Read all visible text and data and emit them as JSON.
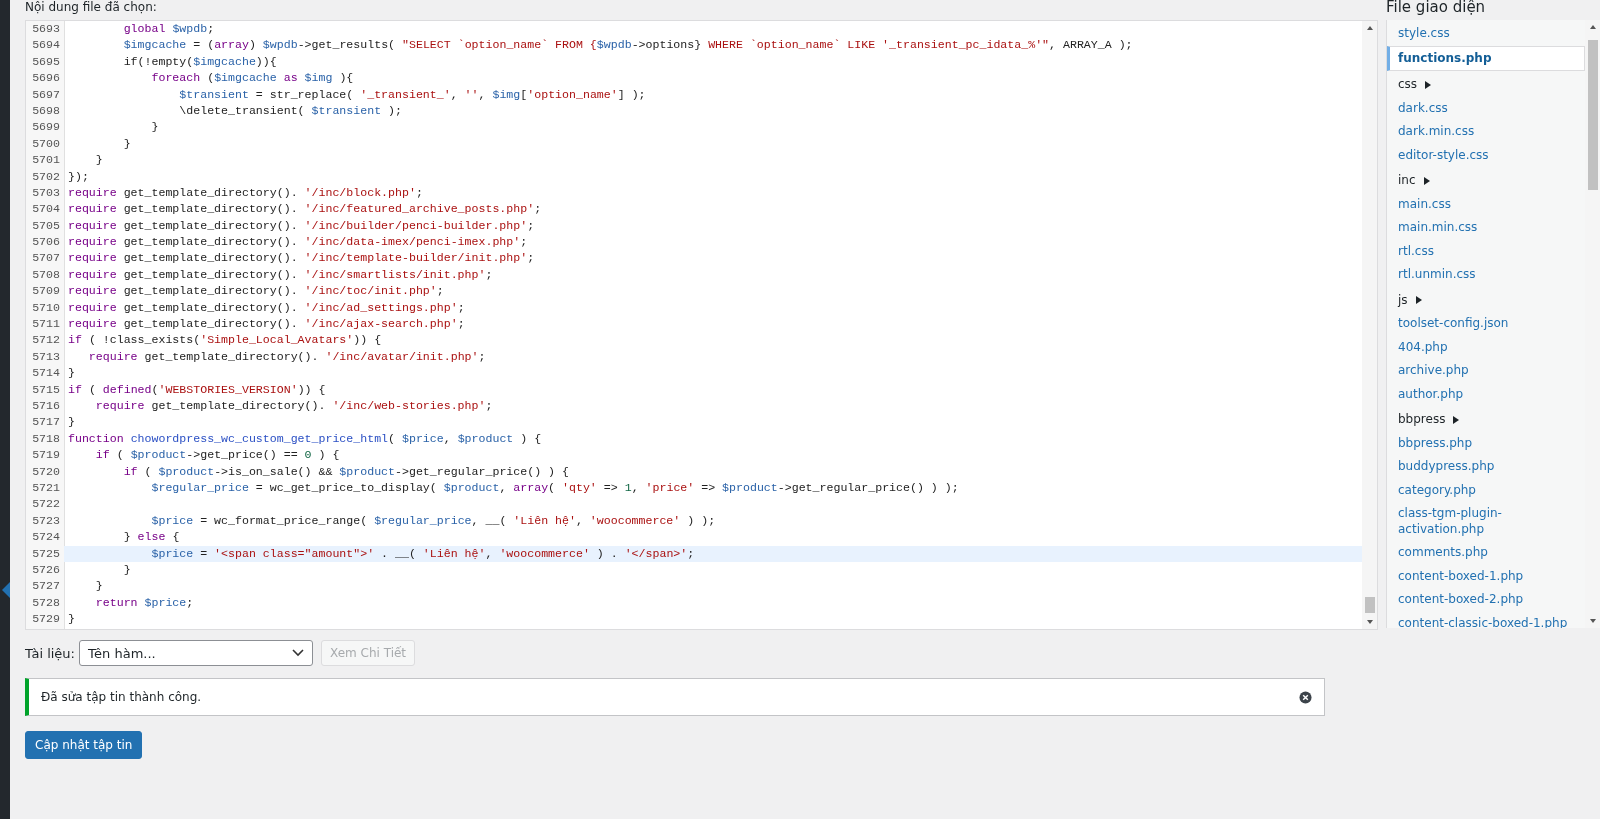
{
  "editor": {
    "heading": "Nội dung file đã chọn:",
    "lines": [
      {
        "number": "5693",
        "highlighted": false,
        "tokens": [
          {
            "kind": "keyword",
            "text": "        global "
          },
          {
            "kind": "variable",
            "text": "$wpdb"
          },
          {
            "kind": "plain",
            "text": ";"
          }
        ]
      },
      {
        "number": "5694",
        "highlighted": false,
        "tokens": [
          {
            "kind": "variable",
            "text": "        $imgcache"
          },
          {
            "kind": "plain",
            "text": " = ("
          },
          {
            "kind": "keyword",
            "text": "array"
          },
          {
            "kind": "plain",
            "text": ") "
          },
          {
            "kind": "variable",
            "text": "$wpdb"
          },
          {
            "kind": "plain",
            "text": "->get_results( "
          },
          {
            "kind": "string",
            "text": "\"SELECT `option_name` FROM {"
          },
          {
            "kind": "variable",
            "text": "$wpdb"
          },
          {
            "kind": "plain",
            "text": "->options}"
          },
          {
            "kind": "string",
            "text": " WHERE `option_name` LIKE '_transient_pc_idata_%'\""
          },
          {
            "kind": "plain",
            "text": ", ARRAY_A );"
          }
        ]
      },
      {
        "number": "5695",
        "highlighted": false,
        "tokens": [
          {
            "kind": "plain",
            "text": "        if(!empty("
          },
          {
            "kind": "variable",
            "text": "$imgcache"
          },
          {
            "kind": "plain",
            "text": ")){"
          }
        ]
      },
      {
        "number": "5696",
        "highlighted": false,
        "tokens": [
          {
            "kind": "keyword",
            "text": "            foreach"
          },
          {
            "kind": "plain",
            "text": " ("
          },
          {
            "kind": "variable",
            "text": "$imgcache "
          },
          {
            "kind": "keyword",
            "text": "as "
          },
          {
            "kind": "variable",
            "text": "$img"
          },
          {
            "kind": "plain",
            "text": " ){"
          }
        ]
      },
      {
        "number": "5697",
        "highlighted": false,
        "tokens": [
          {
            "kind": "variable",
            "text": "                $transient"
          },
          {
            "kind": "plain",
            "text": " = str_replace( "
          },
          {
            "kind": "string",
            "text": "'_transient_'"
          },
          {
            "kind": "plain",
            "text": ", "
          },
          {
            "kind": "string",
            "text": "''"
          },
          {
            "kind": "plain",
            "text": ", "
          },
          {
            "kind": "variable",
            "text": "$img"
          },
          {
            "kind": "plain",
            "text": "["
          },
          {
            "kind": "string",
            "text": "'option_name'"
          },
          {
            "kind": "plain",
            "text": "] );"
          }
        ]
      },
      {
        "number": "5698",
        "highlighted": false,
        "tokens": [
          {
            "kind": "plain",
            "text": "                \\delete_transient( "
          },
          {
            "kind": "variable",
            "text": "$transient"
          },
          {
            "kind": "plain",
            "text": " );"
          }
        ]
      },
      {
        "number": "5699",
        "highlighted": false,
        "tokens": [
          {
            "kind": "plain",
            "text": "            }"
          }
        ]
      },
      {
        "number": "5700",
        "highlighted": false,
        "tokens": [
          {
            "kind": "plain",
            "text": "        }"
          }
        ]
      },
      {
        "number": "5701",
        "highlighted": false,
        "tokens": [
          {
            "kind": "plain",
            "text": "    }"
          }
        ]
      },
      {
        "number": "5702",
        "highlighted": false,
        "tokens": [
          {
            "kind": "plain",
            "text": "});"
          }
        ]
      },
      {
        "number": "5703",
        "highlighted": false,
        "tokens": [
          {
            "kind": "keyword",
            "text": "require"
          },
          {
            "kind": "plain",
            "text": " get_template_directory(). "
          },
          {
            "kind": "string",
            "text": "'/inc/block.php'"
          },
          {
            "kind": "plain",
            "text": ";"
          }
        ]
      },
      {
        "number": "5704",
        "highlighted": false,
        "tokens": [
          {
            "kind": "keyword",
            "text": "require"
          },
          {
            "kind": "plain",
            "text": " get_template_directory(). "
          },
          {
            "kind": "string",
            "text": "'/inc/featured_archive_posts.php'"
          },
          {
            "kind": "plain",
            "text": ";"
          }
        ]
      },
      {
        "number": "5705",
        "highlighted": false,
        "tokens": [
          {
            "kind": "keyword",
            "text": "require"
          },
          {
            "kind": "plain",
            "text": " get_template_directory(). "
          },
          {
            "kind": "string",
            "text": "'/inc/builder/penci-builder.php'"
          },
          {
            "kind": "plain",
            "text": ";"
          }
        ]
      },
      {
        "number": "5706",
        "highlighted": false,
        "tokens": [
          {
            "kind": "keyword",
            "text": "require"
          },
          {
            "kind": "plain",
            "text": " get_template_directory(). "
          },
          {
            "kind": "string",
            "text": "'/inc/data-imex/penci-imex.php'"
          },
          {
            "kind": "plain",
            "text": ";"
          }
        ]
      },
      {
        "number": "5707",
        "highlighted": false,
        "tokens": [
          {
            "kind": "keyword",
            "text": "require"
          },
          {
            "kind": "plain",
            "text": " get_template_directory(). "
          },
          {
            "kind": "string",
            "text": "'/inc/template-builder/init.php'"
          },
          {
            "kind": "plain",
            "text": ";"
          }
        ]
      },
      {
        "number": "5708",
        "highlighted": false,
        "tokens": [
          {
            "kind": "keyword",
            "text": "require"
          },
          {
            "kind": "plain",
            "text": " get_template_directory(). "
          },
          {
            "kind": "string",
            "text": "'/inc/smartlists/init.php'"
          },
          {
            "kind": "plain",
            "text": ";"
          }
        ]
      },
      {
        "number": "5709",
        "highlighted": false,
        "tokens": [
          {
            "kind": "keyword",
            "text": "require"
          },
          {
            "kind": "plain",
            "text": " get_template_directory(). "
          },
          {
            "kind": "string",
            "text": "'/inc/toc/init.php'"
          },
          {
            "kind": "plain",
            "text": ";"
          }
        ]
      },
      {
        "number": "5710",
        "highlighted": false,
        "tokens": [
          {
            "kind": "keyword",
            "text": "require"
          },
          {
            "kind": "plain",
            "text": " get_template_directory(). "
          },
          {
            "kind": "string",
            "text": "'/inc/ad_settings.php'"
          },
          {
            "kind": "plain",
            "text": ";"
          }
        ]
      },
      {
        "number": "5711",
        "highlighted": false,
        "tokens": [
          {
            "kind": "keyword",
            "text": "require"
          },
          {
            "kind": "plain",
            "text": " get_template_directory(). "
          },
          {
            "kind": "string",
            "text": "'/inc/ajax-search.php'"
          },
          {
            "kind": "plain",
            "text": ";"
          }
        ]
      },
      {
        "number": "5712",
        "highlighted": false,
        "tokens": [
          {
            "kind": "keyword",
            "text": "if"
          },
          {
            "kind": "plain",
            "text": " ( !class_exists("
          },
          {
            "kind": "string",
            "text": "'Simple_Local_Avatars'"
          },
          {
            "kind": "plain",
            "text": ")) {"
          }
        ]
      },
      {
        "number": "5713",
        "highlighted": false,
        "tokens": [
          {
            "kind": "keyword",
            "text": "   require"
          },
          {
            "kind": "plain",
            "text": " get_template_directory(). "
          },
          {
            "kind": "string",
            "text": "'/inc/avatar/init.php'"
          },
          {
            "kind": "plain",
            "text": ";"
          }
        ]
      },
      {
        "number": "5714",
        "highlighted": false,
        "tokens": [
          {
            "kind": "plain",
            "text": "}"
          }
        ]
      },
      {
        "number": "5715",
        "highlighted": false,
        "tokens": [
          {
            "kind": "keyword",
            "text": "if"
          },
          {
            "kind": "plain",
            "text": " ( "
          },
          {
            "kind": "keyword",
            "text": "defined"
          },
          {
            "kind": "plain",
            "text": "("
          },
          {
            "kind": "string",
            "text": "'WEBSTORIES_VERSION'"
          },
          {
            "kind": "plain",
            "text": ")) {"
          }
        ]
      },
      {
        "number": "5716",
        "highlighted": false,
        "tokens": [
          {
            "kind": "keyword",
            "text": "    require"
          },
          {
            "kind": "plain",
            "text": " get_template_directory(). "
          },
          {
            "kind": "string",
            "text": "'/inc/web-stories.php'"
          },
          {
            "kind": "plain",
            "text": ";"
          }
        ]
      },
      {
        "number": "5717",
        "highlighted": false,
        "tokens": [
          {
            "kind": "plain",
            "text": "}"
          }
        ]
      },
      {
        "number": "5718",
        "highlighted": false,
        "tokens": [
          {
            "kind": "keyword",
            "text": "function "
          },
          {
            "kind": "def",
            "text": "chowordpress_wc_custom_get_price_html"
          },
          {
            "kind": "plain",
            "text": "( "
          },
          {
            "kind": "variable",
            "text": "$price"
          },
          {
            "kind": "plain",
            "text": ", "
          },
          {
            "kind": "variable",
            "text": "$product"
          },
          {
            "kind": "plain",
            "text": " ) {"
          }
        ]
      },
      {
        "number": "5719",
        "highlighted": false,
        "tokens": [
          {
            "kind": "keyword",
            "text": "    if"
          },
          {
            "kind": "plain",
            "text": " ( "
          },
          {
            "kind": "variable",
            "text": "$product"
          },
          {
            "kind": "plain",
            "text": "->get_price() == "
          },
          {
            "kind": "number",
            "text": "0"
          },
          {
            "kind": "plain",
            "text": " ) {"
          }
        ]
      },
      {
        "number": "5720",
        "highlighted": false,
        "tokens": [
          {
            "kind": "keyword",
            "text": "        if"
          },
          {
            "kind": "plain",
            "text": " ( "
          },
          {
            "kind": "variable",
            "text": "$product"
          },
          {
            "kind": "plain",
            "text": "->is_on_sale() && "
          },
          {
            "kind": "variable",
            "text": "$product"
          },
          {
            "kind": "plain",
            "text": "->get_regular_price() ) {"
          }
        ]
      },
      {
        "number": "5721",
        "highlighted": false,
        "tokens": [
          {
            "kind": "variable",
            "text": "            $regular_price"
          },
          {
            "kind": "plain",
            "text": " = wc_get_price_to_display( "
          },
          {
            "kind": "variable",
            "text": "$product"
          },
          {
            "kind": "plain",
            "text": ", "
          },
          {
            "kind": "keyword",
            "text": "array"
          },
          {
            "kind": "plain",
            "text": "( "
          },
          {
            "kind": "string",
            "text": "'qty'"
          },
          {
            "kind": "plain",
            "text": " => "
          },
          {
            "kind": "number",
            "text": "1"
          },
          {
            "kind": "plain",
            "text": ", "
          },
          {
            "kind": "string",
            "text": "'price'"
          },
          {
            "kind": "plain",
            "text": " => "
          },
          {
            "kind": "variable",
            "text": "$product"
          },
          {
            "kind": "plain",
            "text": "->get_regular_price() ) );"
          }
        ]
      },
      {
        "number": "5722",
        "highlighted": false
      },
      {
        "number": "5723",
        "highlighted": false,
        "tokens": [
          {
            "kind": "variable",
            "text": "            $price"
          },
          {
            "kind": "plain",
            "text": " = wc_format_price_range( "
          },
          {
            "kind": "variable",
            "text": "$regular_price"
          },
          {
            "kind": "plain",
            "text": ", __( "
          },
          {
            "kind": "string",
            "text": "'Liên hệ'"
          },
          {
            "kind": "plain",
            "text": ", "
          },
          {
            "kind": "string",
            "text": "'woocommerce'"
          },
          {
            "kind": "plain",
            "text": " ) );"
          }
        ]
      },
      {
        "number": "5724",
        "highlighted": false,
        "tokens": [
          {
            "kind": "plain",
            "text": "        } "
          },
          {
            "kind": "keyword",
            "text": "else"
          },
          {
            "kind": "plain",
            "text": " {"
          }
        ]
      },
      {
        "number": "5725",
        "highlighted": true,
        "tokens": [
          {
            "kind": "variable",
            "text": "            $price"
          },
          {
            "kind": "plain",
            "text": " = "
          },
          {
            "kind": "string",
            "text": "'<span class=\"amount\">'"
          },
          {
            "kind": "plain",
            "text": " . __( "
          },
          {
            "kind": "string",
            "text": "'Liên hệ'"
          },
          {
            "kind": "plain",
            "text": ", "
          },
          {
            "kind": "string",
            "text": "'woocommerce'"
          },
          {
            "kind": "plain",
            "text": " ) . "
          },
          {
            "kind": "string",
            "text": "'</span>'"
          },
          {
            "kind": "plain",
            "text": ";"
          }
        ]
      },
      {
        "number": "5726",
        "highlighted": false,
        "tokens": [
          {
            "kind": "plain",
            "text": "        }"
          }
        ]
      },
      {
        "number": "5727",
        "highlighted": false,
        "tokens": [
          {
            "kind": "plain",
            "text": "    }"
          }
        ]
      },
      {
        "number": "5728",
        "highlighted": false,
        "tokens": [
          {
            "kind": "keyword",
            "text": "    return "
          },
          {
            "kind": "variable",
            "text": "$price"
          },
          {
            "kind": "plain",
            "text": ";"
          }
        ]
      },
      {
        "number": "5729",
        "highlighted": false,
        "tokens": [
          {
            "kind": "plain",
            "text": "}"
          }
        ]
      }
    ]
  },
  "documentation": {
    "label": "Tài liệu:",
    "select_value": "Tên hàm...",
    "button": {
      "label": "Xem Chi Tiết",
      "disabled": true
    }
  },
  "notice": {
    "kind": "success",
    "message": "Đã sửa tập tin thành công."
  },
  "submit_button": "Cập nhật tập tin",
  "theme_files": {
    "heading": "File giao diện",
    "items": [
      {
        "label": "style.css",
        "kind": "file",
        "selected": false
      },
      {
        "label": "functions.php",
        "kind": "file",
        "selected": true
      },
      {
        "label": "css",
        "kind": "folder",
        "selected": false
      },
      {
        "label": "dark.css",
        "kind": "file",
        "selected": false
      },
      {
        "label": "dark.min.css",
        "kind": "file",
        "selected": false
      },
      {
        "label": "editor-style.css",
        "kind": "file",
        "selected": false
      },
      {
        "label": "inc",
        "kind": "folder",
        "selected": false
      },
      {
        "label": "main.css",
        "kind": "file",
        "selected": false
      },
      {
        "label": "main.min.css",
        "kind": "file",
        "selected": false
      },
      {
        "label": "rtl.css",
        "kind": "file",
        "selected": false
      },
      {
        "label": "rtl.unmin.css",
        "kind": "file",
        "selected": false
      },
      {
        "label": "js",
        "kind": "folder",
        "selected": false
      },
      {
        "label": "toolset-config.json",
        "kind": "file",
        "selected": false
      },
      {
        "label": "404.php",
        "kind": "file",
        "selected": false
      },
      {
        "label": "archive.php",
        "kind": "file",
        "selected": false
      },
      {
        "label": "author.php",
        "kind": "file",
        "selected": false
      },
      {
        "label": "bbpress",
        "kind": "folder",
        "selected": false
      },
      {
        "label": "bbpress.php",
        "kind": "file",
        "selected": false
      },
      {
        "label": "buddypress.php",
        "kind": "file",
        "selected": false
      },
      {
        "label": "category.php",
        "kind": "file",
        "selected": false
      },
      {
        "label": "class-tgm-plugin-activation.php",
        "kind": "file",
        "selected": false
      },
      {
        "label": "comments.php",
        "kind": "file",
        "selected": false
      },
      {
        "label": "content-boxed-1.php",
        "kind": "file",
        "selected": false
      },
      {
        "label": "content-boxed-2.php",
        "kind": "file",
        "selected": false
      },
      {
        "label": "content-classic-boxed-1.php",
        "kind": "file",
        "selected": false
      }
    ]
  }
}
